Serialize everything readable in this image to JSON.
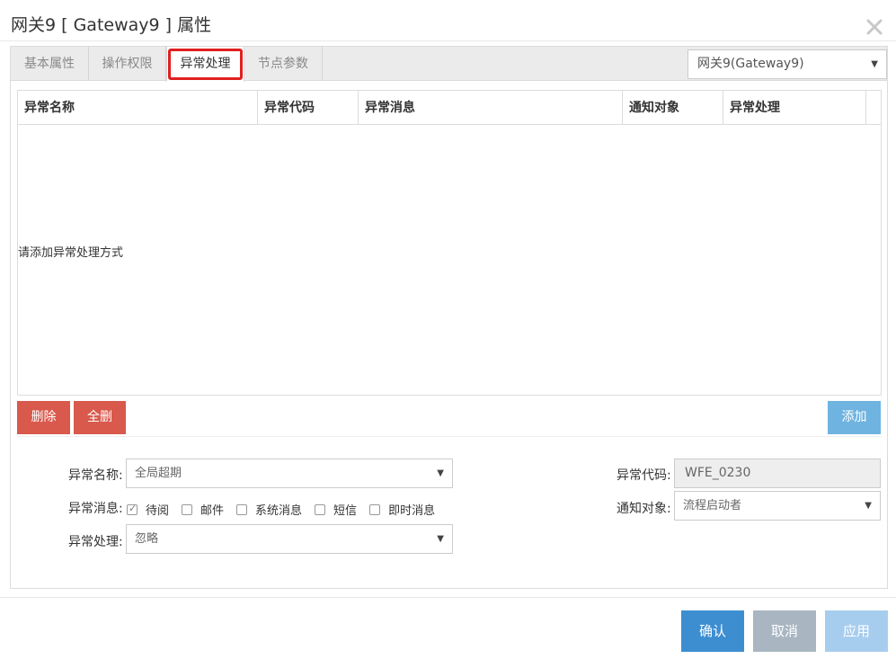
{
  "window": {
    "title": "网关9 [ Gateway9 ] 属性"
  },
  "tabs": [
    {
      "label": "基本属性"
    },
    {
      "label": "操作权限"
    },
    {
      "label": "异常处理"
    },
    {
      "label": "节点参数"
    }
  ],
  "node_select": {
    "value": "网关9(Gateway9)"
  },
  "grid": {
    "columns": [
      "异常名称",
      "异常代码",
      "异常消息",
      "通知对象",
      "异常处理"
    ],
    "empty_text": "请添加异常处理方式"
  },
  "actions": {
    "delete": "删除",
    "delete_all": "全删",
    "add": "添加"
  },
  "form": {
    "name_label": "异常名称:",
    "name_value": "全局超期",
    "code_label": "异常代码:",
    "code_value": "WFE_0230",
    "message_label": "异常消息:",
    "message_options": [
      {
        "label": "待阅",
        "checked": true
      },
      {
        "label": "邮件",
        "checked": false
      },
      {
        "label": "系统消息",
        "checked": false
      },
      {
        "label": "短信",
        "checked": false
      },
      {
        "label": "即时消息",
        "checked": false
      }
    ],
    "notify_label": "通知对象:",
    "notify_value": "流程启动者",
    "handle_label": "异常处理:",
    "handle_value": "忽略"
  },
  "footer": {
    "confirm": "确认",
    "cancel": "取消",
    "apply": "应用"
  },
  "colors": {
    "danger": "#d9594c",
    "primary": "#3d8ed1",
    "muted": "#a9b6c2",
    "primary_light": "#a7cdee",
    "tab_focus": "#e02020"
  }
}
